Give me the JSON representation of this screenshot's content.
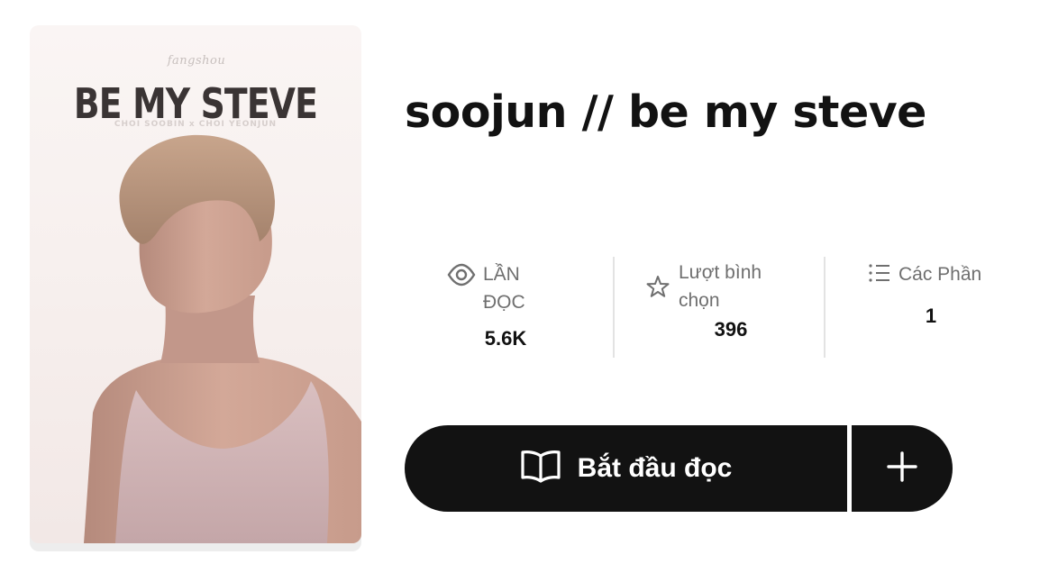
{
  "cover": {
    "signature": "fangshou",
    "title": "BE MY STEVE",
    "subtitle": "CHOI SOOBIN x CHOI YEONJUN"
  },
  "story": {
    "title": "soojun // be my steve"
  },
  "stats": {
    "reads": {
      "label": "LẦN ĐỌC",
      "value": "5.6K",
      "icon": "eye-icon"
    },
    "votes": {
      "label": "Lượt bình chọn",
      "value": "396",
      "icon": "star-icon"
    },
    "parts": {
      "label": "Các Phần",
      "value": "1",
      "icon": "list-icon"
    }
  },
  "actions": {
    "start_reading": {
      "label": "Bắt đầu đọc",
      "icon": "book-open-icon"
    },
    "add": {
      "icon": "plus-icon"
    }
  },
  "colors": {
    "button_bg": "#121212",
    "label_gray": "#6f6f6f",
    "divider": "#e3e3e3"
  }
}
